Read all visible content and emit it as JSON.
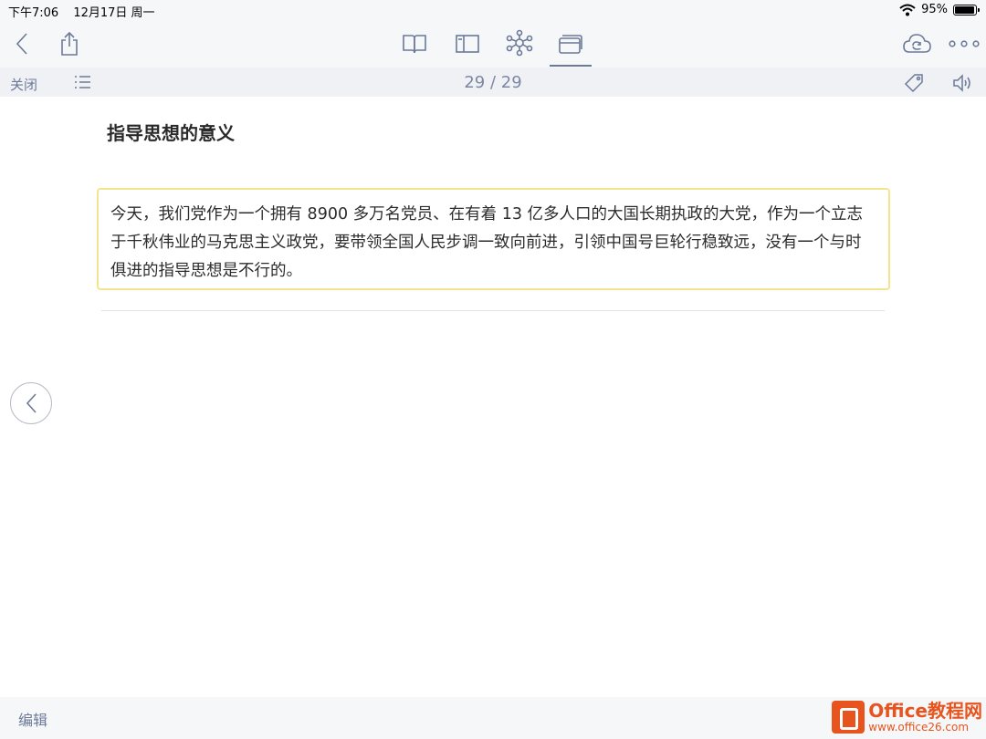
{
  "status_bar": {
    "time": "下午7:06",
    "date": "12月17日 周一",
    "battery_percent": "95%",
    "battery_level": 0.95
  },
  "toolbar": {
    "left_icons": [
      "back-chevron-icon",
      "share-icon"
    ],
    "center_tabs": [
      "book-icon",
      "panel-view-icon",
      "mindmap-icon",
      "card-view-icon"
    ],
    "active_tab": "card-view-icon",
    "right_icons": [
      "cloud-sync-icon",
      "more-icon"
    ]
  },
  "subbar": {
    "close_label": "关闭",
    "page_counter": "29 / 29"
  },
  "content": {
    "heading": "指导思想的意义",
    "body": "今天，我们党作为一个拥有 8900 多万名党员、在有着 13 亿多人口的大国长期执政的大党，作为一个立志于千秋伟业的马克思主义政党，要带领全国人民步调一致向前进，引领中国号巨轮行稳致远，没有一个与时俱进的指导思想是不行的。"
  },
  "bottom_bar": {
    "edit_label": "编辑"
  },
  "watermark": {
    "main": "Office教程网",
    "sub": "www.office26.com"
  },
  "colors": {
    "accent": "#6b7a99",
    "card_border": "#f3e58e",
    "watermark": "#e8541e"
  }
}
